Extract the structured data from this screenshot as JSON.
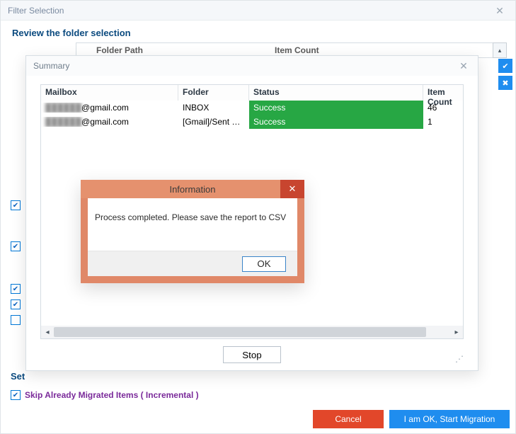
{
  "outer": {
    "title": "Filter Selection",
    "review_heading": "Review the folder selection",
    "folder_table": {
      "col_path": "Folder Path",
      "col_count": "Item Count"
    },
    "settings_label_short": "Set",
    "skip_label": "Skip Already Migrated Items ( Incremental )",
    "btn_cancel": "Cancel",
    "btn_start": "I am OK, Start Migration"
  },
  "left_checks": [
    {
      "checked": true
    },
    {
      "checked": true
    },
    {
      "checked": true
    },
    {
      "checked": true
    },
    {
      "checked": false
    }
  ],
  "skip_checked": true,
  "summary": {
    "title": "Summary",
    "columns": {
      "mailbox": "Mailbox",
      "folder": "Folder",
      "status": "Status",
      "item_count": "Item Count"
    },
    "rows": [
      {
        "mailbox_hidden": "██████",
        "mailbox_domain": "@gmail.com",
        "folder": "INBOX",
        "status": "Success",
        "item_count": "46"
      },
      {
        "mailbox_hidden": "██████",
        "mailbox_domain": "@gmail.com",
        "folder": "[Gmail]/Sent Mail",
        "status": "Success",
        "item_count": "1"
      }
    ],
    "btn_stop": "Stop"
  },
  "info_dialog": {
    "title": "Information",
    "message": "Process completed. Please save the report to CSV",
    "btn_ok": "OK"
  }
}
